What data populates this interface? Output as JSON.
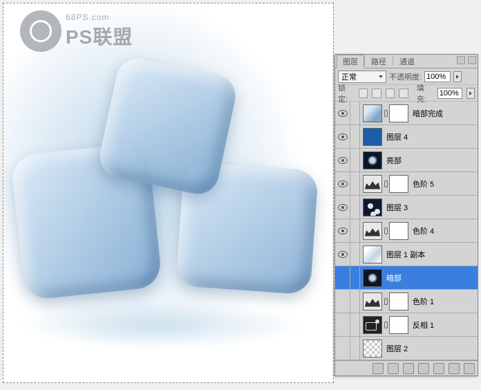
{
  "watermark": {
    "url": "68PS.com",
    "brand": "PS联盟"
  },
  "panel": {
    "tabs": {
      "layers": "图层",
      "paths": "路径",
      "channels": "通道"
    },
    "blend_mode": "正常",
    "opacity_label": "不透明度:",
    "opacity_value": "100%",
    "lock_label": "锁定:",
    "fill_label": "填充:",
    "fill_value": "100%"
  },
  "layers": [
    {
      "name": "暗部完成",
      "thumb": "th-ice",
      "mask": true,
      "visible": true
    },
    {
      "name": "图层 4",
      "thumb": "th-blue",
      "mask": false,
      "visible": true
    },
    {
      "name": "亮部",
      "thumb": "th-dark",
      "mask": false,
      "visible": true
    },
    {
      "name": "色阶 5",
      "thumb": "th-levels",
      "mask": true,
      "visible": true
    },
    {
      "name": "图层 3",
      "thumb": "th-shapes",
      "mask": false,
      "visible": true
    },
    {
      "name": "色阶 4",
      "thumb": "th-levels",
      "mask": true,
      "visible": true
    },
    {
      "name": "图层 1 副本",
      "thumb": "th-small-ice",
      "mask": false,
      "visible": true
    },
    {
      "name": "暗部",
      "thumb": "th-dark",
      "mask": false,
      "visible": false,
      "selected": true
    },
    {
      "name": "色阶 1",
      "thumb": "th-levels",
      "mask": true,
      "visible": false
    },
    {
      "name": "反相 1",
      "thumb": "th-invert",
      "mask": true,
      "visible": false
    },
    {
      "name": "图层 2",
      "thumb": "th-checker",
      "mask": false,
      "visible": false
    }
  ]
}
